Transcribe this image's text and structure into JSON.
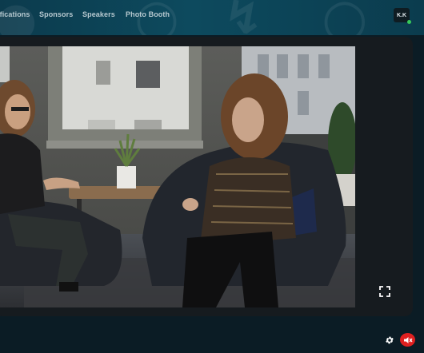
{
  "nav": {
    "items": [
      {
        "label": "ifications"
      },
      {
        "label": "Sponsors"
      },
      {
        "label": "Speakers"
      },
      {
        "label": "Photo Booth"
      }
    ]
  },
  "user": {
    "initials": "K.K",
    "status_color": "#36c95a"
  },
  "player": {
    "controls": {
      "fullscreen_icon": "fullscreen-icon",
      "settings_icon": "gear-icon",
      "mute_icon": "speaker-muted-icon"
    },
    "mute_button_color": "#e02020",
    "muted": true
  },
  "theme": {
    "topbar_color": "#0d4a5e",
    "background": "#0b1c25",
    "card_color": "#161b1f"
  }
}
